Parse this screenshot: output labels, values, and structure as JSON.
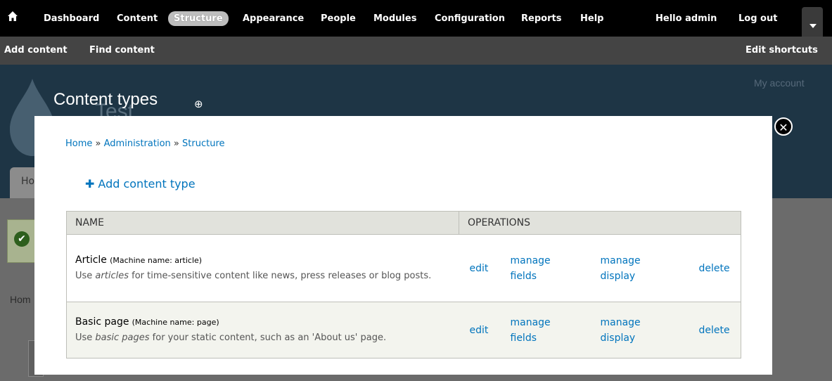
{
  "toolbar": {
    "items": [
      {
        "label": "Dashboard"
      },
      {
        "label": "Content"
      },
      {
        "label": "Structure",
        "active": true
      },
      {
        "label": "Appearance"
      },
      {
        "label": "People"
      },
      {
        "label": "Modules"
      },
      {
        "label": "Configuration"
      },
      {
        "label": "Reports"
      },
      {
        "label": "Help"
      }
    ],
    "greeting_prefix": "Hello ",
    "username": "admin",
    "logout": "Log out",
    "home_icon": "home-icon",
    "toggle_icon": "chevron-down-icon"
  },
  "shortcuts": {
    "items": [
      {
        "label": "Add content"
      },
      {
        "label": "Find content"
      }
    ],
    "edit": "Edit shortcuts"
  },
  "background_page": {
    "site_name": "Test",
    "my_account": "My account",
    "home_tab": "Ho",
    "breadcrumb": "Hom"
  },
  "overlay": {
    "title": "Content types",
    "title_icon": "add-shortcut-icon",
    "close_icon": "close-icon",
    "breadcrumb": [
      "Home",
      "Administration",
      "Structure"
    ],
    "breadcrumb_sep": "»",
    "add_link": "Add content type",
    "table": {
      "headers": [
        "Name",
        "Operations"
      ],
      "rows": [
        {
          "name": "Article",
          "machine": "(Machine name: article)",
          "desc_prefix": "Use ",
          "desc_em": "articles",
          "desc_suffix": " for time-sensitive content like news, press releases or blog posts.",
          "ops": {
            "edit": "edit",
            "manage_fields_1": "manage",
            "manage_fields_2": "fields",
            "manage_display_1": "manage",
            "manage_display_2": "display",
            "delete": "delete"
          }
        },
        {
          "name": "Basic page",
          "machine": "(Machine name: page)",
          "desc_prefix": "Use ",
          "desc_em": "basic pages",
          "desc_suffix": " for your static content, such as an 'About us' page.",
          "ops": {
            "edit": "edit",
            "manage_fields_1": "manage",
            "manage_fields_2": "fields",
            "manage_display_1": "manage",
            "manage_display_2": "display",
            "delete": "delete"
          }
        }
      ]
    }
  },
  "colors": {
    "link": "#0074bd",
    "toolbar_bg": "#000000",
    "shortcut_bg": "#444444",
    "active_pill": "#bdbdbd"
  }
}
